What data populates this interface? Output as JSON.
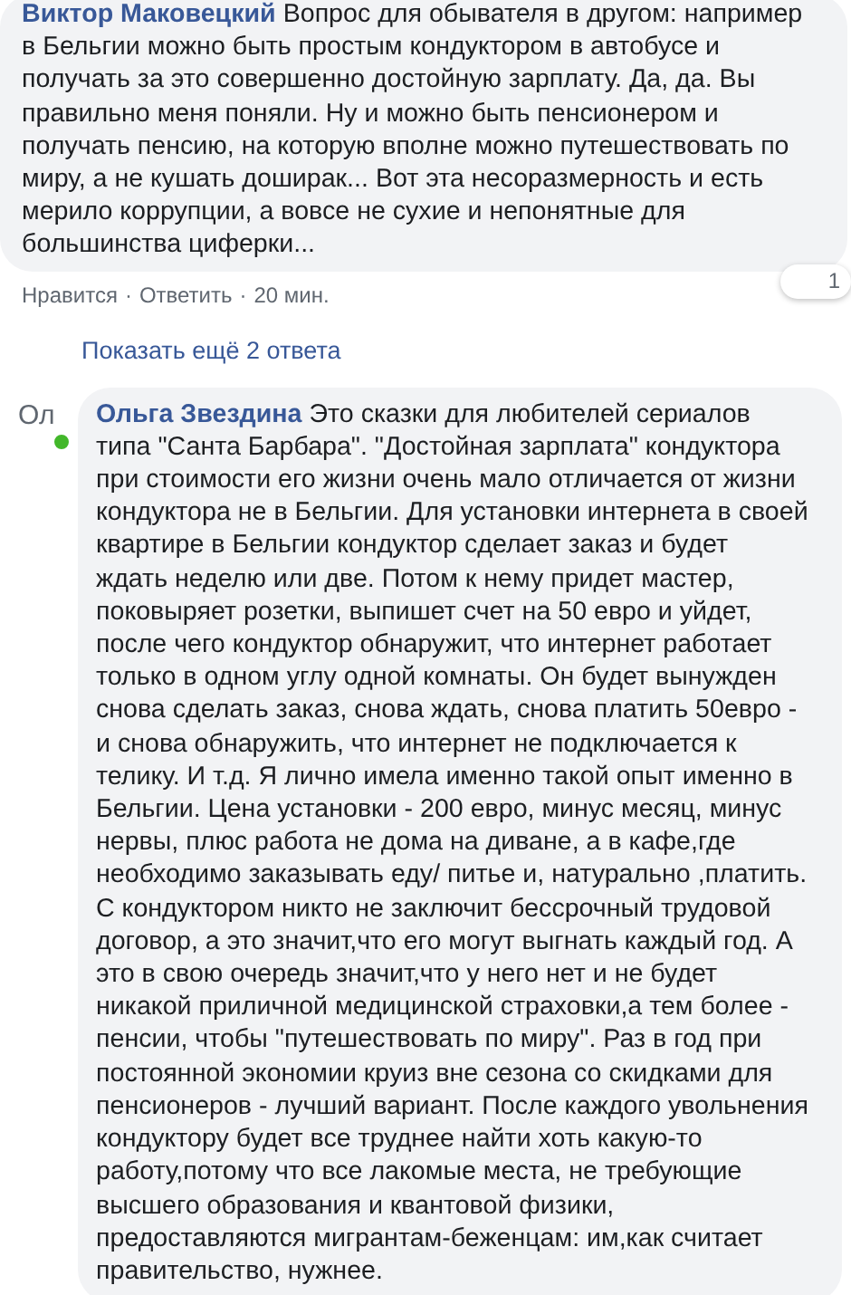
{
  "comment": {
    "author": "Виктор Маковецкий",
    "text": "Вопрос для обывателя в другом: например\nв Бельгии можно быть простым кондуктором в автобусе и\nполучать за это совершенно достойную зарплату. Да, да. Вы\nправильно меня поняли. Ну и можно быть пенсионером и\nполучать пенсию, на которую вполне можно путешествовать по\nмиру, а не кушать доширак... Вот эта несоразмерность и есть\nмерило коррупции, а вовсе не сухие и непонятные для\nбольшинства циферки...",
    "reaction_count": "1",
    "actions": [
      "Нравится",
      "Ответить"
    ],
    "separator": "·",
    "time": "20 мин."
  },
  "show_more": "Показать ещё 2 ответа",
  "reply": {
    "avatar_text": "Ол",
    "online": true,
    "author": "Ольга Звездина",
    "text": "Это сказки для любителей сериалов\nтипа \"Санта Барбара\". \"Достойная зарплата\" кондуктора\nпри стоимости его жизни очень мало отличается от жизни\nкондуктора не в Бельгии. Для установки интернета в своей\nквартире в Бельгии кондуктор сделает заказ и будет\nждать неделю или две. Потом к нему придет мастер,\nпоковыряет розетки, выпишет счет на 50 евро и уйдет,\nпосле чего кондуктор обнаружит, что интернет работает\nтолько в одном углу одной комнаты. Он будет вынужден\nснова сделать заказ, снова ждать, снова платить 50евро -\nи снова обнаружить, что интернет не подключается к\nтелику. И т.д. Я лично имела именно такой опыт именно в\nБельгии. Цена установки - 200 евро, минус месяц, минус\nнервы, плюс работа не дома на диване, а в кафе,где\nнеобходимо заказывать еду/ питье и, натурально ,платить.\nС кондуктором никто не заключит бессрочный трудовой\nдоговор, а это значит,что его могут выгнать каждый год. А\nэто в свою очередь значит,что у него нет и не будет\nникакой приличной медицинской страховки,а тем более -\nпенсии, чтобы \"путешествовать по миру\". Раз в год при\nпостоянной экономии круиз вне сезона со скидками для\nпенсионеров - лучший вариант. После каждого увольнения\nкондуктору будет все труднее найти хоть какую-то\nработу,потому что все лакомые места, не требующие\nвысшего образования и квантовой физики,\nпредоставляются мигрантам-беженцам: им,как считает\nправительство, нужнее."
  }
}
